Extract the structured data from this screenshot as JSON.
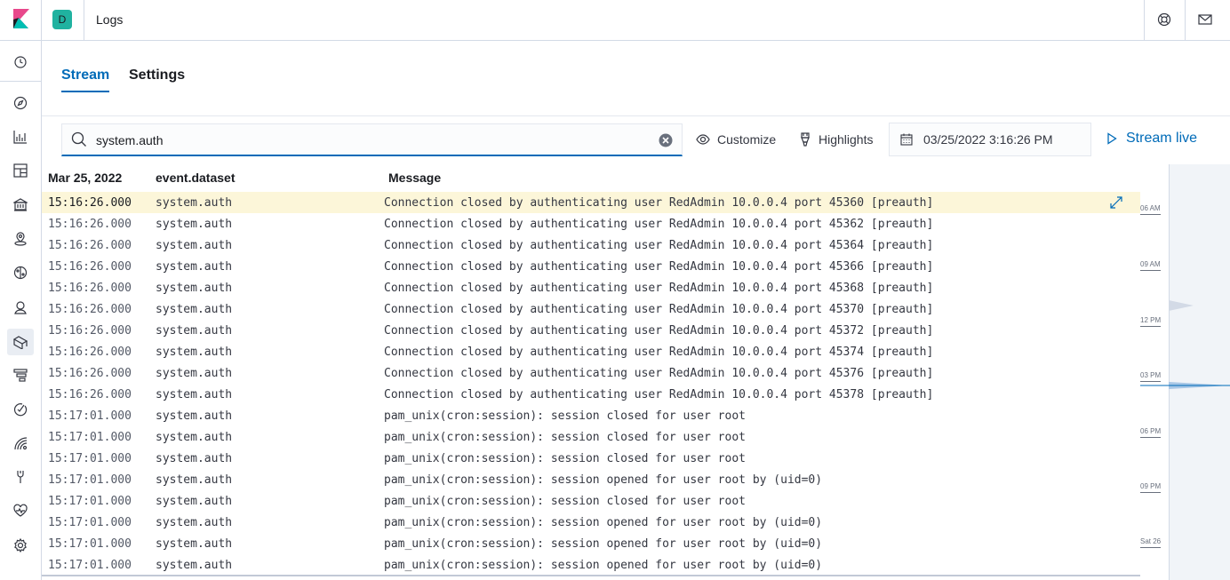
{
  "header": {
    "space_initial": "D",
    "breadcrumb": "Logs",
    "space_color": "#20b2a0"
  },
  "nav": {
    "icons": [
      "clock-icon",
      "compass-icon",
      "visualize-icon",
      "dashboard-icon",
      "canvas-icon",
      "maps-icon",
      "ml-icon",
      "graph-icon",
      "logs-icon",
      "apm-icon",
      "uptime-icon",
      "siem-icon",
      "dev-tools-icon",
      "monitoring-icon",
      "management-icon"
    ],
    "active": "logs-icon"
  },
  "tabs": [
    {
      "label": "Stream",
      "selected": true
    },
    {
      "label": "Settings",
      "selected": false
    }
  ],
  "toolbar": {
    "search_value": "system.auth",
    "customize_label": "Customize",
    "highlights_label": "Highlights",
    "date_value": "03/25/2022 3:16:26 PM",
    "stream_live_label": "Stream live"
  },
  "table": {
    "headers": {
      "date": "Mar 25, 2022",
      "dataset": "event.dataset",
      "message": "Message"
    },
    "rows": [
      {
        "time": "15:16:26.000",
        "dataset": "system.auth",
        "message": "Connection closed by authenticating user RedAdmin 10.0.0.4 port 45360 [preauth]",
        "highlighted": true
      },
      {
        "time": "15:16:26.000",
        "dataset": "system.auth",
        "message": "Connection closed by authenticating user RedAdmin 10.0.0.4 port 45362 [preauth]"
      },
      {
        "time": "15:16:26.000",
        "dataset": "system.auth",
        "message": "Connection closed by authenticating user RedAdmin 10.0.0.4 port 45364 [preauth]"
      },
      {
        "time": "15:16:26.000",
        "dataset": "system.auth",
        "message": "Connection closed by authenticating user RedAdmin 10.0.0.4 port 45366 [preauth]"
      },
      {
        "time": "15:16:26.000",
        "dataset": "system.auth",
        "message": "Connection closed by authenticating user RedAdmin 10.0.0.4 port 45368 [preauth]"
      },
      {
        "time": "15:16:26.000",
        "dataset": "system.auth",
        "message": "Connection closed by authenticating user RedAdmin 10.0.0.4 port 45370 [preauth]"
      },
      {
        "time": "15:16:26.000",
        "dataset": "system.auth",
        "message": "Connection closed by authenticating user RedAdmin 10.0.0.4 port 45372 [preauth]"
      },
      {
        "time": "15:16:26.000",
        "dataset": "system.auth",
        "message": "Connection closed by authenticating user RedAdmin 10.0.0.4 port 45374 [preauth]"
      },
      {
        "time": "15:16:26.000",
        "dataset": "system.auth",
        "message": "Connection closed by authenticating user RedAdmin 10.0.0.4 port 45376 [preauth]"
      },
      {
        "time": "15:16:26.000",
        "dataset": "system.auth",
        "message": "Connection closed by authenticating user RedAdmin 10.0.0.4 port 45378 [preauth]"
      },
      {
        "time": "15:17:01.000",
        "dataset": "system.auth",
        "message": "pam_unix(cron:session): session closed for user root"
      },
      {
        "time": "15:17:01.000",
        "dataset": "system.auth",
        "message": "pam_unix(cron:session): session closed for user root"
      },
      {
        "time": "15:17:01.000",
        "dataset": "system.auth",
        "message": "pam_unix(cron:session): session closed for user root"
      },
      {
        "time": "15:17:01.000",
        "dataset": "system.auth",
        "message": "pam_unix(cron:session): session opened for user root by (uid=0)"
      },
      {
        "time": "15:17:01.000",
        "dataset": "system.auth",
        "message": "pam_unix(cron:session): session closed for user root"
      },
      {
        "time": "15:17:01.000",
        "dataset": "system.auth",
        "message": "pam_unix(cron:session): session opened for user root by (uid=0)"
      },
      {
        "time": "15:17:01.000",
        "dataset": "system.auth",
        "message": "pam_unix(cron:session): session opened for user root by (uid=0)"
      },
      {
        "time": "15:17:01.000",
        "dataset": "system.auth",
        "message": "pam_unix(cron:session): session opened for user root by (uid=0)"
      }
    ]
  },
  "minimap": {
    "labels": [
      "06 AM",
      "09 AM",
      "12 PM",
      "03 PM",
      "06 PM",
      "09 PM",
      "Sat 26"
    ]
  },
  "colors": {
    "accent": "#006bb8",
    "highlight_row": "#fcf6d9"
  }
}
